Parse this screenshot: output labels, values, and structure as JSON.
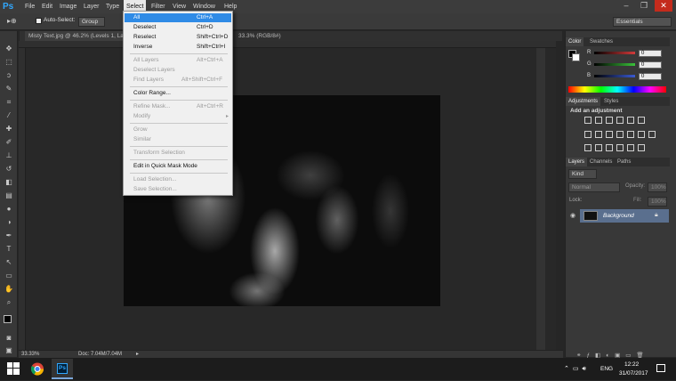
{
  "menubar": {
    "logo": "Ps",
    "items": [
      "File",
      "Edit",
      "Image",
      "Layer",
      "Type",
      "Select",
      "Filter",
      "View",
      "Window",
      "Help"
    ],
    "active": "Select",
    "window_buttons": [
      "–",
      "❐",
      "✕"
    ]
  },
  "options_bar": {
    "auto_select_label": "Auto-Select:",
    "auto_select_value": "Group",
    "workspace": "Essentials"
  },
  "document": {
    "tab_title": "Misty Text.jpg @ 46.2% (Levels 1, Layer",
    "tab_title_suffix": "33.3% (RGB/8#)",
    "zoom": "33.33%",
    "doc_info": "Doc: 7.04M/7.04M"
  },
  "select_menu": {
    "items": [
      {
        "label": "All",
        "shortcut": "Ctrl+A",
        "state": "highlighted"
      },
      {
        "label": "Deselect",
        "shortcut": "Ctrl+D",
        "state": "enabled"
      },
      {
        "label": "Reselect",
        "shortcut": "Shift+Ctrl+D",
        "state": "enabled"
      },
      {
        "label": "Inverse",
        "shortcut": "Shift+Ctrl+I",
        "state": "enabled"
      },
      {
        "label": "All Layers",
        "shortcut": "Alt+Ctrl+A",
        "state": "disabled"
      },
      {
        "label": "Deselect Layers",
        "shortcut": "",
        "state": "disabled"
      },
      {
        "label": "Find Layers",
        "shortcut": "Alt+Shift+Ctrl+F",
        "state": "disabled"
      },
      {
        "label": "Color Range...",
        "shortcut": "",
        "state": "enabled"
      },
      {
        "label": "Refine Mask...",
        "shortcut": "Alt+Ctrl+R",
        "state": "disabled"
      },
      {
        "label": "Modify",
        "shortcut": "",
        "state": "disabled"
      },
      {
        "label": "Grow",
        "shortcut": "",
        "state": "disabled"
      },
      {
        "label": "Similar",
        "shortcut": "",
        "state": "disabled"
      },
      {
        "label": "Transform Selection",
        "shortcut": "",
        "state": "disabled"
      },
      {
        "label": "Edit in Quick Mask Mode",
        "shortcut": "",
        "state": "enabled"
      },
      {
        "label": "Load Selection...",
        "shortcut": "",
        "state": "disabled"
      },
      {
        "label": "Save Selection...",
        "shortcut": "",
        "state": "disabled"
      }
    ]
  },
  "color_panel": {
    "tabs": [
      "Color",
      "Swatches"
    ],
    "channels": [
      {
        "label": "R",
        "value": "0",
        "color": "#d23a3a"
      },
      {
        "label": "G",
        "value": "0",
        "color": "#3ac23a"
      },
      {
        "label": "B",
        "value": "0",
        "color": "#3a5ad2"
      }
    ]
  },
  "adjustments_panel": {
    "tabs": [
      "Adjustments",
      "Styles"
    ],
    "heading": "Add an adjustment"
  },
  "layers_panel": {
    "tabs": [
      "Layers",
      "Channels",
      "Paths"
    ],
    "kind_label": "Kind",
    "blend_mode": "Normal",
    "opacity_label": "Opacity:",
    "opacity_value": "100%",
    "lock_label": "Lock:",
    "fill_label": "Fill:",
    "fill_value": "100%",
    "layer_name": "Background"
  },
  "taskbar": {
    "language": "ENG",
    "time": "12:22",
    "date": "31/07/2017",
    "apps": [
      "chrome-icon",
      "photoshop-icon"
    ]
  }
}
